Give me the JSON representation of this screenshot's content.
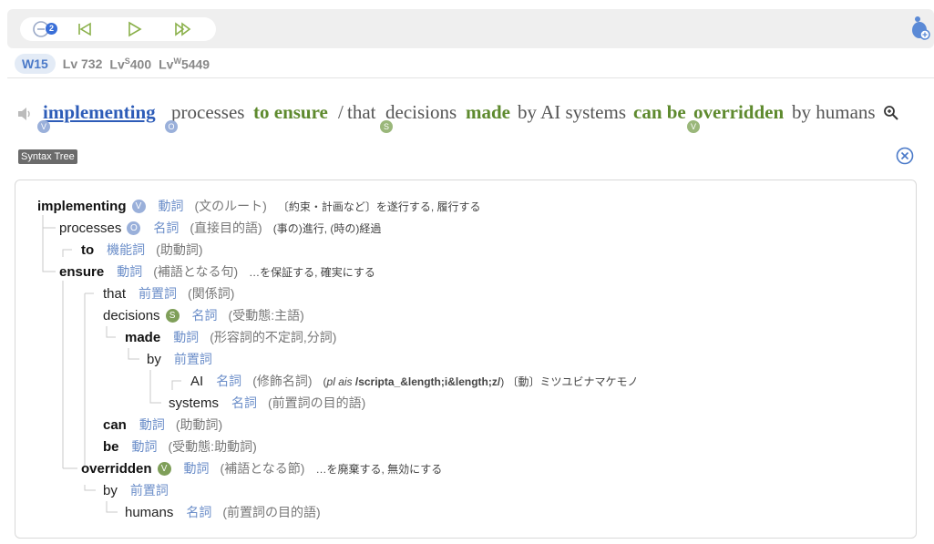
{
  "toolbar": {
    "badge": "2",
    "icons": [
      "minus-circle-icon",
      "skip-back-icon",
      "play-icon",
      "fast-forward-icon"
    ],
    "mascot_icon": "mascot-icon"
  },
  "levels": {
    "w": "W15",
    "lv": "Lv 732",
    "lvs_prefix": "Lv",
    "lvs_sup": "S",
    "lvs_val": "400",
    "lvw_prefix": "Lv",
    "lvw_sup": "W",
    "lvw_val": "5449"
  },
  "sentence": {
    "w1": "implementing",
    "w2": "processes",
    "w3": "to ensure",
    "w4": "/",
    "w5": "that",
    "w6": "decisions",
    "w7": "made",
    "w8": "by AI systems",
    "w9": "can be",
    "w10": "overridden",
    "w11": "by humans",
    "tag1": "V",
    "tag2": "O",
    "tag3": "S",
    "tag4": "V"
  },
  "syntax_tree_label": "Syntax Tree",
  "tree": [
    {
      "word": "implementing",
      "tag": "V",
      "pos": "動詞",
      "role": "(文のルート)",
      "gloss": "〔約束・計画など〕を遂行する, 履行する"
    },
    {
      "word": "processes",
      "tag": "O",
      "pos": "名詞",
      "role": "(直接目的語)",
      "gloss": "(事の)進行, (時の)経過"
    },
    {
      "word": "to",
      "pos": "機能詞",
      "role": "(助動詞)"
    },
    {
      "word": "ensure",
      "pos": "動詞",
      "role": "(補語となる句)",
      "gloss": "…を保証する, 確実にする"
    },
    {
      "word": "that",
      "pos": "前置詞",
      "role": "(関係詞)"
    },
    {
      "word": "decisions",
      "tag": "S",
      "pos": "名詞",
      "role": "(受動態:主語)"
    },
    {
      "word": "made",
      "pos": "動詞",
      "role": "(形容詞的不定詞,分詞)"
    },
    {
      "word": "by",
      "pos": "前置詞"
    },
    {
      "word": "AI",
      "pos": "名詞",
      "role": "(修飾名詞)",
      "gloss_pre": "(",
      "gloss_it": "pl ais",
      "gloss_bold": " /scripta_&length;i&length;z/",
      "gloss_post": ") 〔動〕ミツユビナマケモノ"
    },
    {
      "word": "systems",
      "pos": "名詞",
      "role": "(前置詞の目的語)"
    },
    {
      "word": "can",
      "pos": "動詞",
      "role": "(助動詞)"
    },
    {
      "word": "be",
      "pos": "動詞",
      "role": "(受動態:助動詞)"
    },
    {
      "word": "overridden",
      "tag": "V",
      "pos": "動詞",
      "role": "(補語となる節)",
      "gloss": "…を廃棄する, 無効にする"
    },
    {
      "word": "by",
      "pos": "前置詞"
    },
    {
      "word": "humans",
      "pos": "名詞",
      "role": "(前置詞の目的語)"
    }
  ]
}
